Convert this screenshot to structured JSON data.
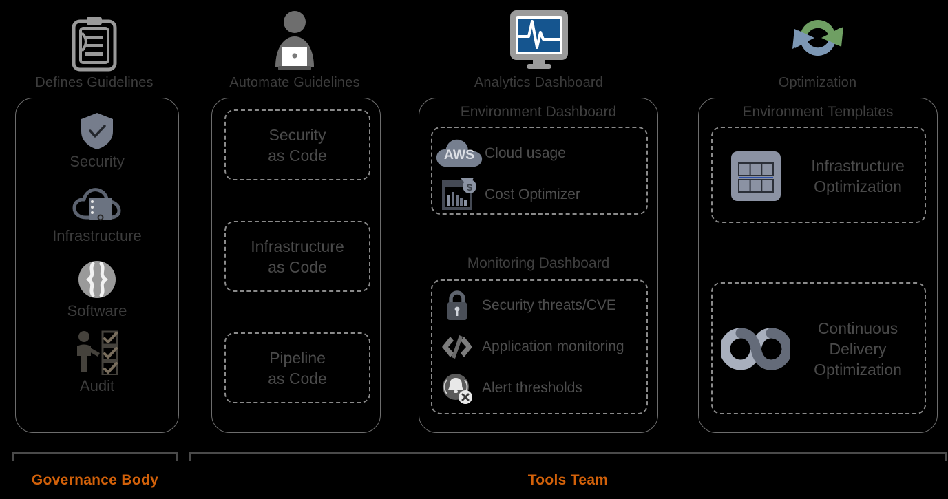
{
  "columns": [
    {
      "header": {
        "icon": "clipboard-icon",
        "label": "Defines Guidelines"
      },
      "items": [
        {
          "icon": "shield-check-icon",
          "label": "Security"
        },
        {
          "icon": "cloud-server-icon",
          "label": "Infrastructure"
        },
        {
          "icon": "code-braces-circle-icon",
          "label": "Software"
        },
        {
          "icon": "person-checklist-icon",
          "label": "Audit"
        }
      ]
    },
    {
      "header": {
        "icon": "person-laptop-icon",
        "label": "Automate Guidelines"
      },
      "boxes": [
        {
          "line1": "Security",
          "line2": "as Code"
        },
        {
          "line1": "Infrastructure",
          "line2": "as Code"
        },
        {
          "line1": "Pipeline",
          "line2": "as Code"
        }
      ]
    },
    {
      "header": {
        "icon": "monitor-pulse-icon",
        "label": "Analytics Dashboard"
      },
      "card_title": "Environment Dashboard",
      "env_rows": [
        {
          "icon": "aws-cloud-icon",
          "label": "Cloud usage"
        },
        {
          "icon": "cost-chart-icon",
          "label": "Cost Optimizer"
        }
      ],
      "section_title": "Monitoring Dashboard",
      "mon_rows": [
        {
          "icon": "lock-icon",
          "label": "Security threats/CVE"
        },
        {
          "icon": "code-brackets-icon",
          "label": "Application monitoring"
        },
        {
          "icon": "alert-bell-icon",
          "label": "Alert thresholds"
        }
      ]
    },
    {
      "header": {
        "icon": "refresh-cycle-icon",
        "label": "Optimization"
      },
      "card_title": "Environment Templates",
      "templates": [
        {
          "icon": "server-grid-icon",
          "line1": "Infrastructure",
          "line2": "Optimization",
          "line3": ""
        },
        {
          "icon": "infinity-devops-icon",
          "line1": "Continuous",
          "line2": "Delivery",
          "line3": "Optimization"
        }
      ]
    }
  ],
  "footer": {
    "governance_label": "Governance Body",
    "tools_label": "Tools Team"
  },
  "colors": {
    "accent_orange": "#D2610A",
    "icon_gray": "#7b8290",
    "monitor_blue": "#1b5c96",
    "arrow_green": "#6f9f63",
    "arrow_blue": "#7c97b4",
    "text_gray": "#3c3c3c",
    "border_gray": "#6d6d6d",
    "dash_gray": "#8a8a8a"
  }
}
